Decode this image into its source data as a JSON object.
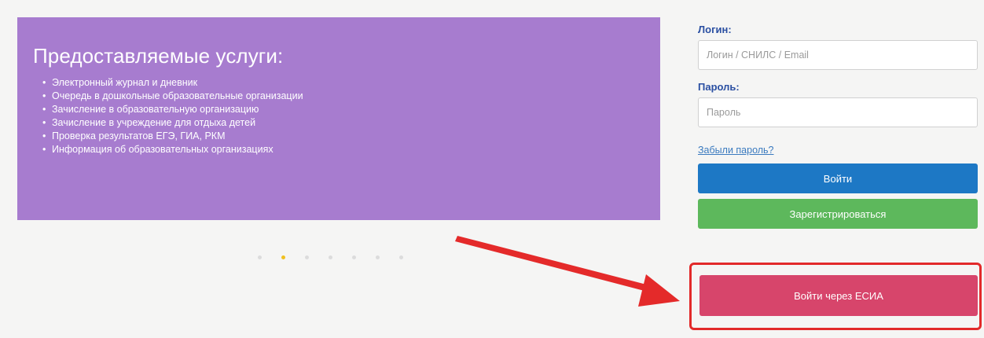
{
  "services": {
    "title": "Предоставляемые услуги:",
    "items": [
      "Электронный журнал и дневник",
      "Очередь в дошкольные образовательные организации",
      "Зачисление в образовательную организацию",
      "Зачисление в учреждение для отдыха детей",
      "Проверка результатов ЕГЭ, ГИА, РКМ",
      "Информация об образовательных организациях"
    ]
  },
  "carousel": {
    "active_index": 1,
    "total": 7
  },
  "login": {
    "login_label": "Логин:",
    "login_placeholder": "Логин / СНИЛС / Email",
    "password_label": "Пароль:",
    "password_placeholder": "Пароль",
    "forgot_link": "Забыли пароль?",
    "login_button": "Войти",
    "register_button": "Зарегистрироваться",
    "esia_button": "Войти через ЕСИА"
  },
  "colors": {
    "banner": "#a77ccf",
    "label": "#2a4fa2",
    "login_button": "#1d78c5",
    "register_button": "#5db85c",
    "esia_button": "#d7456b",
    "highlight": "#e22a2a"
  }
}
